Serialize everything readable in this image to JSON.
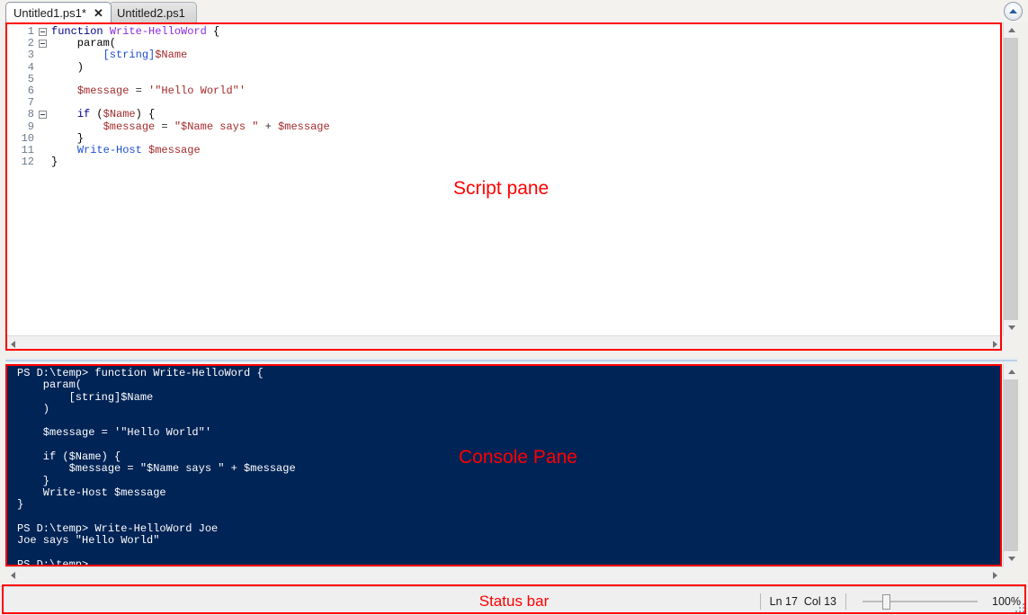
{
  "window": {
    "collapse_button_title": "Collapse",
    "collapse_icon": "chevron-up-icon"
  },
  "tabs": [
    {
      "label": "Untitled1.ps1*",
      "close": "✕",
      "active": true
    },
    {
      "label": "Untitled2.ps1",
      "close": "",
      "active": false
    }
  ],
  "script_pane": {
    "lines": [
      {
        "no": "1",
        "fold": true,
        "guide": false,
        "tokens": [
          {
            "t": "function",
            "c": "t-kw"
          },
          {
            "t": " ",
            "c": "t-plain"
          },
          {
            "t": "Write-HelloWord",
            "c": "t-fn"
          },
          {
            "t": " {",
            "c": "t-plain"
          }
        ]
      },
      {
        "no": "2",
        "fold": true,
        "guide": false,
        "tokens": [
          {
            "t": "    param(",
            "c": "t-plain"
          }
        ]
      },
      {
        "no": "3",
        "fold": false,
        "guide": true,
        "tokens": [
          {
            "t": "        ",
            "c": "t-plain"
          },
          {
            "t": "[string]",
            "c": "t-type"
          },
          {
            "t": "$Name",
            "c": "t-var"
          }
        ]
      },
      {
        "no": "4",
        "fold": false,
        "guide": true,
        "tokens": [
          {
            "t": "    )",
            "c": "t-plain"
          }
        ]
      },
      {
        "no": "5",
        "fold": false,
        "guide": true,
        "tokens": [
          {
            "t": "",
            "c": "t-plain"
          }
        ]
      },
      {
        "no": "6",
        "fold": false,
        "guide": true,
        "tokens": [
          {
            "t": "    ",
            "c": "t-plain"
          },
          {
            "t": "$message",
            "c": "t-var"
          },
          {
            "t": " = ",
            "c": "t-op"
          },
          {
            "t": "'\"Hello World\"'",
            "c": "t-str"
          }
        ]
      },
      {
        "no": "7",
        "fold": false,
        "guide": true,
        "tokens": [
          {
            "t": "",
            "c": "t-plain"
          }
        ]
      },
      {
        "no": "8",
        "fold": true,
        "guide": false,
        "tokens": [
          {
            "t": "    ",
            "c": "t-plain"
          },
          {
            "t": "if",
            "c": "t-kw"
          },
          {
            "t": " (",
            "c": "t-plain"
          },
          {
            "t": "$Name",
            "c": "t-var"
          },
          {
            "t": ") {",
            "c": "t-plain"
          }
        ]
      },
      {
        "no": "9",
        "fold": false,
        "guide": true,
        "tokens": [
          {
            "t": "        ",
            "c": "t-plain"
          },
          {
            "t": "$message",
            "c": "t-var"
          },
          {
            "t": " = ",
            "c": "t-op"
          },
          {
            "t": "\"$Name says \"",
            "c": "t-str"
          },
          {
            "t": " + ",
            "c": "t-op"
          },
          {
            "t": "$message",
            "c": "t-var"
          }
        ]
      },
      {
        "no": "10",
        "fold": false,
        "guide": true,
        "tokens": [
          {
            "t": "    }",
            "c": "t-plain"
          }
        ]
      },
      {
        "no": "11",
        "fold": false,
        "guide": true,
        "tokens": [
          {
            "t": "    ",
            "c": "t-plain"
          },
          {
            "t": "Write-Host",
            "c": "t-cmd"
          },
          {
            "t": " ",
            "c": "t-plain"
          },
          {
            "t": "$message",
            "c": "t-var"
          }
        ]
      },
      {
        "no": "12",
        "fold": false,
        "guide": true,
        "tokens": [
          {
            "t": "}",
            "c": "t-plain"
          }
        ]
      }
    ]
  },
  "console_pane": {
    "text": "PS D:\\temp> function Write-HelloWord {\n    param(\n        [string]$Name\n    )\n\n    $message = '\"Hello World\"'\n\n    if ($Name) {\n        $message = \"$Name says \" + $message\n    }\n    Write-Host $message\n}\n\nPS D:\\temp> Write-HelloWord Joe\nJoe says \"Hello World\"\n\nPS D:\\temp>"
  },
  "status_bar": {
    "line_col": "Ln 17  Col 13",
    "zoom_percent": "100%",
    "zoom_value": 100
  },
  "annotations": {
    "script_pane_label": "Script pane",
    "console_pane_label": "Console Pane",
    "status_bar_label": "Status bar",
    "color": "#ff0000"
  },
  "scrollbars": {
    "up_arrow": "chevron-up-icon",
    "down_arrow": "chevron-down-icon",
    "left_arrow": "chevron-left-icon",
    "right_arrow": "chevron-right-icon"
  }
}
